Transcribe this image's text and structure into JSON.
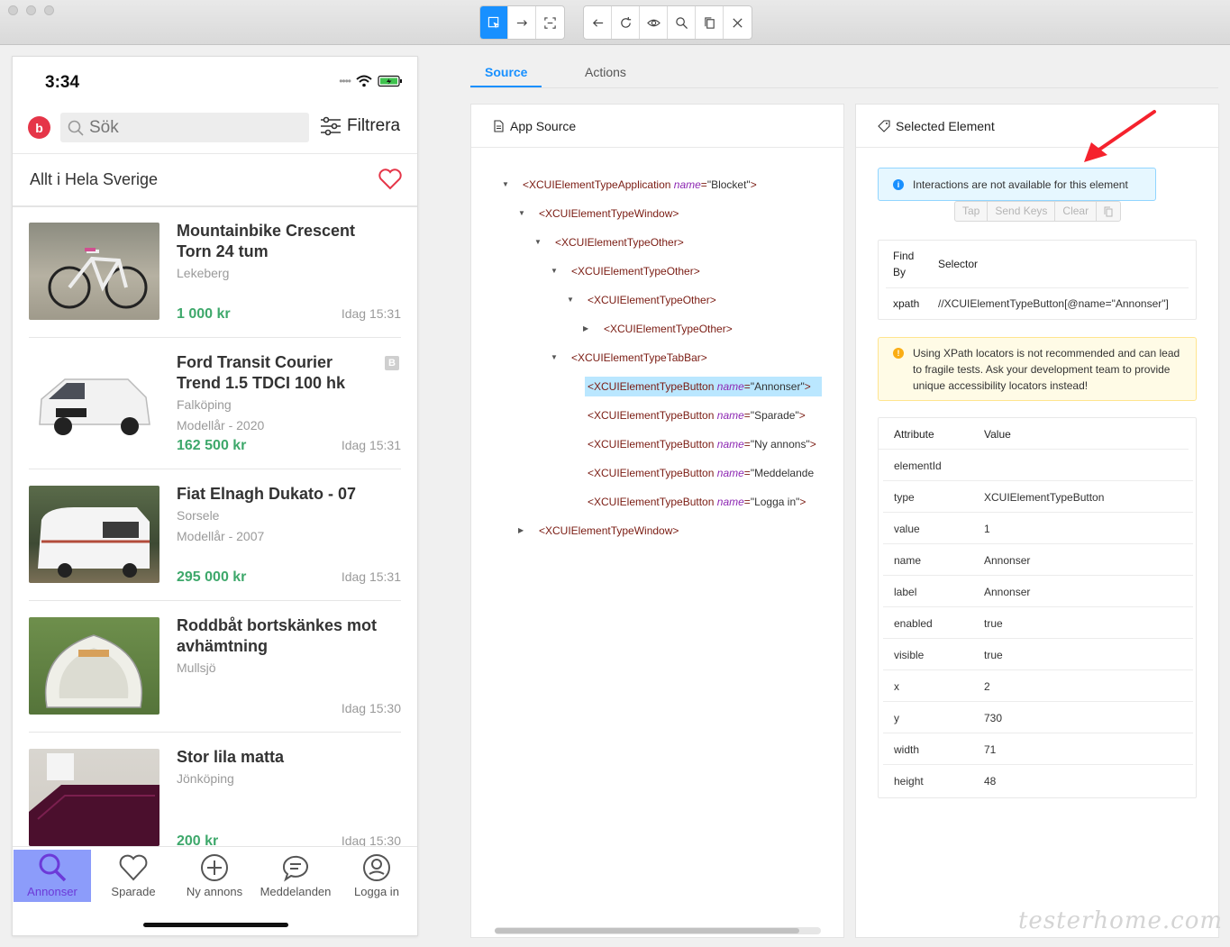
{
  "toolbar": {
    "group1": [
      "select-element-icon",
      "swipe-icon",
      "tap-coordinates-icon"
    ],
    "group2": [
      "back-icon",
      "refresh-icon",
      "show-hide-icon",
      "search-icon",
      "copy-xml-icon",
      "quit-icon"
    ]
  },
  "phone": {
    "time": "3:34",
    "search_placeholder": "Sök",
    "filter_label": "Filtrera",
    "region_label": "Allt i Hela Sverige",
    "listings": [
      {
        "title": "Mountainbike Crescent Torn 24 tum",
        "location": "Lekeberg",
        "year": "",
        "price": "1 000 kr",
        "time": "Idag 15:31",
        "badge": ""
      },
      {
        "title": "Ford Transit Courier Trend 1.5 TDCI 100 hk",
        "location": "Falköping",
        "year": "Modellår - 2020",
        "price": "162 500 kr",
        "time": "Idag 15:31",
        "badge": "B"
      },
      {
        "title": "Fiat Elnagh Dukato - 07",
        "location": "Sorsele",
        "year": "Modellår - 2007",
        "price": "295 000 kr",
        "time": "Idag 15:31",
        "badge": ""
      },
      {
        "title": "Roddbåt bortskänkes mot avhämtning",
        "location": "Mullsjö",
        "year": "",
        "price": "",
        "time": "Idag 15:30",
        "badge": ""
      },
      {
        "title": "Stor lila matta",
        "location": "Jönköping",
        "year": "",
        "price": "200 kr",
        "time": "Idag 15:30",
        "badge": ""
      }
    ],
    "tabs": [
      {
        "label": "Annonser",
        "icon": "search-icon"
      },
      {
        "label": "Sparade",
        "icon": "heart-icon"
      },
      {
        "label": "Ny annons",
        "icon": "plus-circle-icon"
      },
      {
        "label": "Meddelanden",
        "icon": "chat-icon"
      },
      {
        "label": "Logga in",
        "icon": "user-icon"
      }
    ]
  },
  "inspector": {
    "tabs": {
      "source": "Source",
      "actions": "Actions"
    },
    "app_source": {
      "title": "App Source",
      "nodes": [
        {
          "tag": "<XCUIElementTypeApplication",
          "attr": "name",
          "value": "\"Blocket\"",
          "close": ">",
          "caret": "down"
        },
        {
          "tag": "<XCUIElementTypeWindow>",
          "attr": "",
          "value": "",
          "close": "",
          "caret": "down"
        },
        {
          "tag": "<XCUIElementTypeOther>",
          "attr": "",
          "value": "",
          "close": "",
          "caret": "down"
        },
        {
          "tag": "<XCUIElementTypeOther>",
          "attr": "",
          "value": "",
          "close": "",
          "caret": "down"
        },
        {
          "tag": "<XCUIElementTypeOther>",
          "attr": "",
          "value": "",
          "close": "",
          "caret": "down"
        },
        {
          "tag": "<XCUIElementTypeOther>",
          "attr": "",
          "value": "",
          "close": "",
          "caret": "right"
        },
        {
          "tag": "<XCUIElementTypeTabBar>",
          "attr": "",
          "value": "",
          "close": "",
          "caret": "down"
        },
        {
          "tag": "<XCUIElementTypeButton",
          "attr": "name",
          "value": "\"Annonser\"",
          "close": ">",
          "caret": ""
        },
        {
          "tag": "<XCUIElementTypeButton",
          "attr": "name",
          "value": "\"Sparade\"",
          "close": ">",
          "caret": ""
        },
        {
          "tag": "<XCUIElementTypeButton",
          "attr": "name",
          "value": "\"Ny annons\"",
          "close": ">",
          "caret": ""
        },
        {
          "tag": "<XCUIElementTypeButton",
          "attr": "name",
          "value": "\"Meddelande",
          "close": "",
          "caret": ""
        },
        {
          "tag": "<XCUIElementTypeButton",
          "attr": "name",
          "value": "\"Logga in\"",
          "close": ">",
          "caret": ""
        },
        {
          "tag": "<XCUIElementTypeWindow>",
          "attr": "",
          "value": "",
          "close": "",
          "caret": "right"
        }
      ]
    },
    "selected": {
      "title": "Selected Element",
      "info": "Interactions are not available for this element",
      "actions": [
        "Tap",
        "Send Keys",
        "Clear"
      ],
      "find_by_header": "Find By",
      "selector_header": "Selector",
      "strategy": "xpath",
      "selector": "//XCUIElementTypeButton[@name=\"Annonser\"]",
      "warning": "Using XPath locators is not recommended and can lead to fragile tests. Ask your development team to provide unique accessibility locators instead!",
      "attr_header": "Attribute",
      "value_header": "Value",
      "attributes": [
        {
          "k": "elementId",
          "v": ""
        },
        {
          "k": "type",
          "v": "XCUIElementTypeButton"
        },
        {
          "k": "value",
          "v": "1"
        },
        {
          "k": "name",
          "v": "Annonser"
        },
        {
          "k": "label",
          "v": "Annonser"
        },
        {
          "k": "enabled",
          "v": "true"
        },
        {
          "k": "visible",
          "v": "true"
        },
        {
          "k": "x",
          "v": "2"
        },
        {
          "k": "y",
          "v": "730"
        },
        {
          "k": "width",
          "v": "71"
        },
        {
          "k": "height",
          "v": "48"
        }
      ]
    }
  },
  "watermark": "testerhome.com",
  "colors": {
    "accent": "#1890ff",
    "price": "#3ea86b",
    "annotation_arrow": "#f5222d",
    "brand": "#e53548"
  }
}
